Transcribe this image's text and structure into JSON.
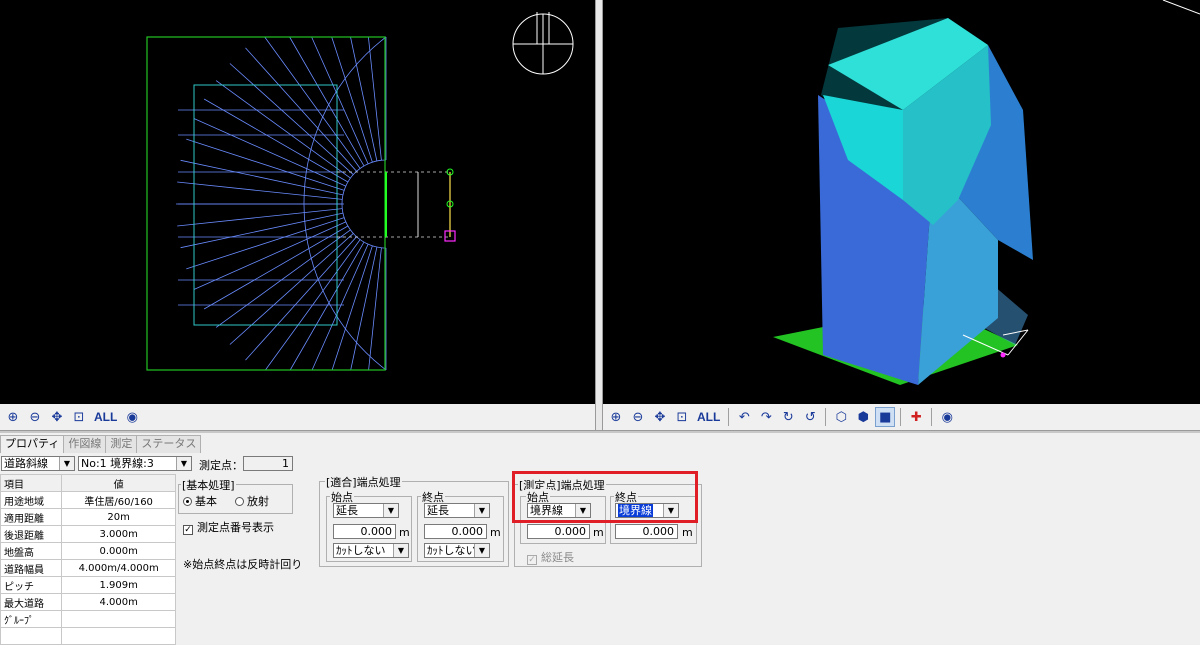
{
  "toolbar2d": {
    "all_label": "ALL"
  },
  "toolbar3d": {
    "all_label": "ALL"
  },
  "tabs": [
    "プロパティ",
    "作図線",
    "測定",
    "ステータス"
  ],
  "line_type_select": "道路斜線",
  "line_no_select": "No:1 境界線:3",
  "measure_point": {
    "label": "測定点：",
    "value": "1"
  },
  "properties": {
    "header_item": "項目",
    "header_value": "値",
    "rows": [
      {
        "k": "用途地域",
        "v": "準住居/60/160"
      },
      {
        "k": "適用距離",
        "v": "20m"
      },
      {
        "k": "後退距離",
        "v": "3.000m"
      },
      {
        "k": "地盤高",
        "v": "0.000m"
      },
      {
        "k": "道路幅員",
        "v": "4.000m/4.000m"
      },
      {
        "k": "ピッチ",
        "v": "1.909m"
      },
      {
        "k": "最大道路",
        "v": "4.000m"
      },
      {
        "k": "ｸﾞﾙｰﾌﾟ",
        "v": ""
      },
      {
        "k": "",
        "v": ""
      }
    ]
  },
  "basic": {
    "title": "[基本処理]",
    "opt1": "基本",
    "opt2": "放射",
    "show_numbers": "測定点番号表示",
    "note": "※始点終点は反時計回り"
  },
  "fit": {
    "title": "[適合]端点処理",
    "start": {
      "title": "始点",
      "mode": "延長",
      "value": "0.000",
      "unit": "m",
      "cut": "ｶｯﾄしない"
    },
    "end": {
      "title": "終点",
      "mode": "延長",
      "value": "0.000",
      "unit": "m",
      "cut": "ｶｯﾄしない"
    }
  },
  "meas": {
    "title": "[測定点]端点処理",
    "start": {
      "title": "始点",
      "mode": "境界線",
      "value": "0.000",
      "unit": "m"
    },
    "end": {
      "title": "終点",
      "mode": "境界線",
      "value": "0.000",
      "unit": "m"
    },
    "total": "総延長"
  },
  "colors": {
    "viewport_bg": "#000000",
    "highlight": "#e01e28",
    "select_blue": "#0a3cd8"
  }
}
